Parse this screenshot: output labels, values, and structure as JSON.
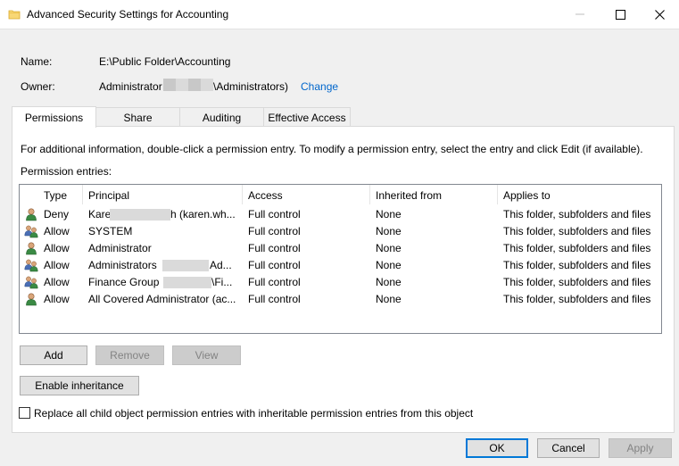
{
  "window": {
    "title": "Advanced Security Settings for Accounting",
    "minimize_icon": "minimize-icon",
    "maximize_icon": "maximize-icon",
    "close_icon": "close-icon"
  },
  "object": {
    "name_label": "Name:",
    "name_value": "E:\\Public Folder\\Accounting",
    "owner_label": "Owner:",
    "owner_value_start": "Administrator",
    "owner_value_end": "\\Administrators)",
    "change_link": "Change"
  },
  "tabs": [
    {
      "label": "Permissions",
      "active": true
    },
    {
      "label": "Share",
      "active": false
    },
    {
      "label": "Auditing",
      "active": false
    },
    {
      "label": "Effective Access",
      "active": false
    }
  ],
  "permissions": {
    "info_text": "For additional information, double-click a permission entry. To modify a permission entry, select the entry and click Edit (if available).",
    "entries_label": "Permission entries:",
    "columns": [
      "Type",
      "Principal",
      "Access",
      "Inherited from",
      "Applies to"
    ],
    "rows": [
      {
        "icon": "user-icon",
        "type": "Deny",
        "principal_start": "Kare",
        "principal_end": "h (karen.wh...",
        "access": "Full control",
        "inherited": "None",
        "applies": "This folder, subfolders and files"
      },
      {
        "icon": "group-icon",
        "type": "Allow",
        "principal_start": "SYSTEM",
        "principal_end": "",
        "access": "Full control",
        "inherited": "None",
        "applies": "This folder, subfolders and files"
      },
      {
        "icon": "user-icon",
        "type": "Allow",
        "principal_start": "Administrator",
        "principal_end": "",
        "access": "Full control",
        "inherited": "None",
        "applies": "This folder, subfolders and files"
      },
      {
        "icon": "group-icon",
        "type": "Allow",
        "principal_start": "Administrators",
        "principal_end": "Ad...",
        "access": "Full control",
        "inherited": "None",
        "applies": "This folder, subfolders and files"
      },
      {
        "icon": "group-icon",
        "type": "Allow",
        "principal_start": "Finance Group",
        "principal_end": "\\Fi...",
        "access": "Full control",
        "inherited": "None",
        "applies": "This folder, subfolders and files"
      },
      {
        "icon": "user-icon",
        "type": "Allow",
        "principal_start": "All Covered Administrator (ac...",
        "principal_end": "",
        "access": "Full control",
        "inherited": "None",
        "applies": "This folder, subfolders and files"
      }
    ],
    "add_button": "Add",
    "remove_button": "Remove",
    "view_button": "View",
    "enable_inheritance_button": "Enable inheritance",
    "replace_checkbox_label": "Replace all child object permission entries with inheritable permission entries from this object",
    "replace_checked": false
  },
  "footer": {
    "ok_button": "OK",
    "cancel_button": "Cancel",
    "apply_button": "Apply"
  },
  "colors": {
    "link": "#0066cc",
    "default_button_border": "#0078d7"
  }
}
